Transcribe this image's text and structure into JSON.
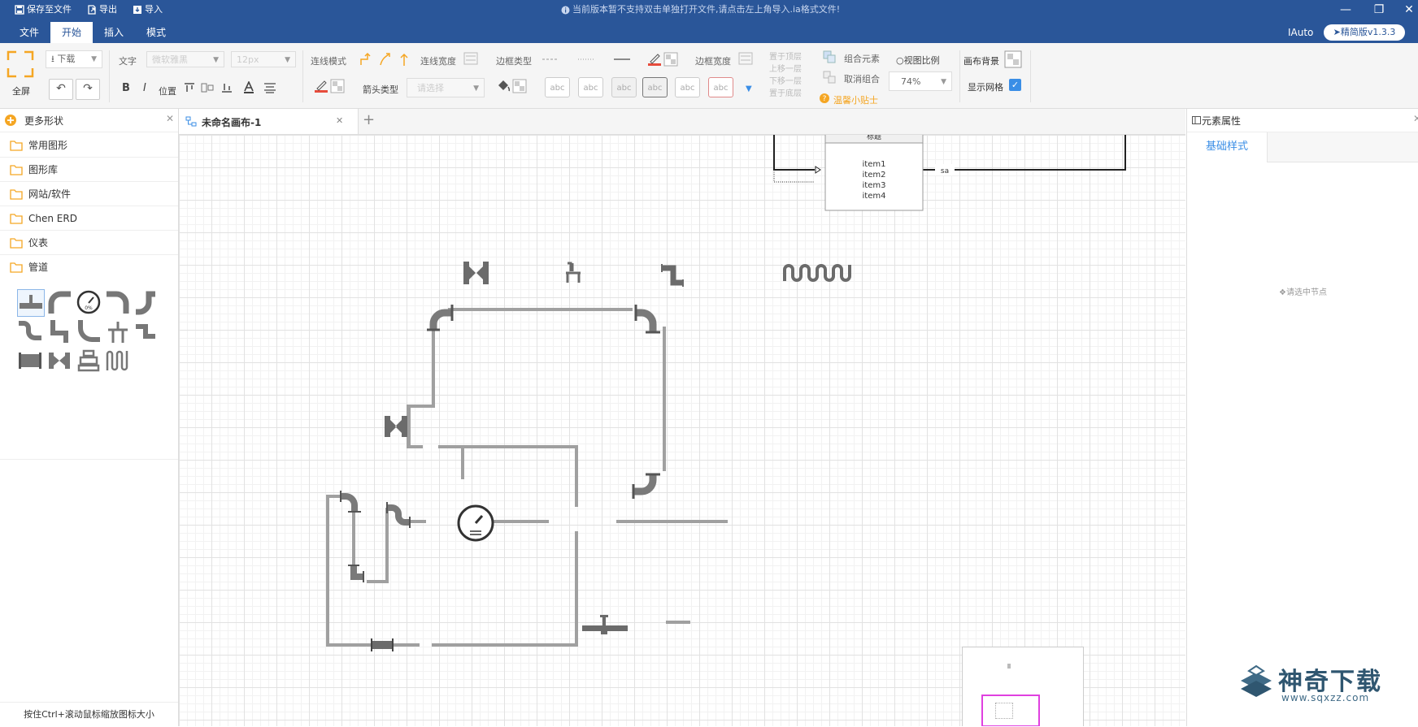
{
  "titlebar": {
    "save_label": "保存至文件",
    "export_label": "导出",
    "import_label": "导入",
    "notice": "当前版本暂不支持双击单独打开文件,请点击左上角导入.ia格式文件!"
  },
  "menubar": {
    "tabs": [
      {
        "label": "文件"
      },
      {
        "label": "开始"
      },
      {
        "label": "插入"
      },
      {
        "label": "模式"
      }
    ],
    "user": "IAuto",
    "version": "精简版v1.3.3"
  },
  "toolbar": {
    "fullscreen_label": "全屏",
    "download_label": "下载",
    "text_label": "文字",
    "font_value": "微软雅黑",
    "size_value": "12px",
    "position_label": "位置",
    "line_mode_label": "连线模式",
    "line_width_label": "连线宽度",
    "edge_type_label": "边框类型",
    "edge_width_label": "边框宽度",
    "arrow_type_label": "箭头类型",
    "arrow_placeholder": "请选择",
    "style_samples": [
      "abc",
      "abc",
      "abc",
      "abc",
      "abc",
      "abc"
    ],
    "layer_items": [
      "置于顶层",
      "上移一层",
      "下移一层",
      "置于底层"
    ],
    "group_label": "组合元素",
    "ungroup_label": "取消组合",
    "tips_label": "温馨小贴士",
    "zoom_label": "视图比例",
    "zoom_value": "74%",
    "canvas_bg_label": "画布背景",
    "show_grid_label": "显示网格",
    "show_grid_checked": true
  },
  "leftpanel": {
    "more_shapes": "更多形状",
    "categories": [
      {
        "label": "常用图形"
      },
      {
        "label": "图形库"
      },
      {
        "label": "网站/软件"
      },
      {
        "label": "Chen ERD"
      },
      {
        "label": "仪表"
      },
      {
        "label": "管道"
      }
    ],
    "footer_hint": "按住Ctrl+滚动鼠标缩放图标大小"
  },
  "tabbar": {
    "tab_label": "未命名画布-1"
  },
  "canvas": {
    "uml_title": "标题",
    "uml_items": [
      "item1",
      "item2",
      "item3",
      "item4"
    ],
    "edge_label": "sa"
  },
  "rightpanel": {
    "title": "元素属性",
    "tab_label": "基础样式",
    "empty_hint": "请选中节点"
  },
  "watermark": {
    "brand": "神奇下载",
    "url": "www.sqxzz.com"
  },
  "colors": {
    "primary": "#2a5699",
    "pipe": "#9a9a9a",
    "pipe_dark": "#666666",
    "accent_orange": "#f5a623",
    "link_blue": "#3a8ee6"
  }
}
